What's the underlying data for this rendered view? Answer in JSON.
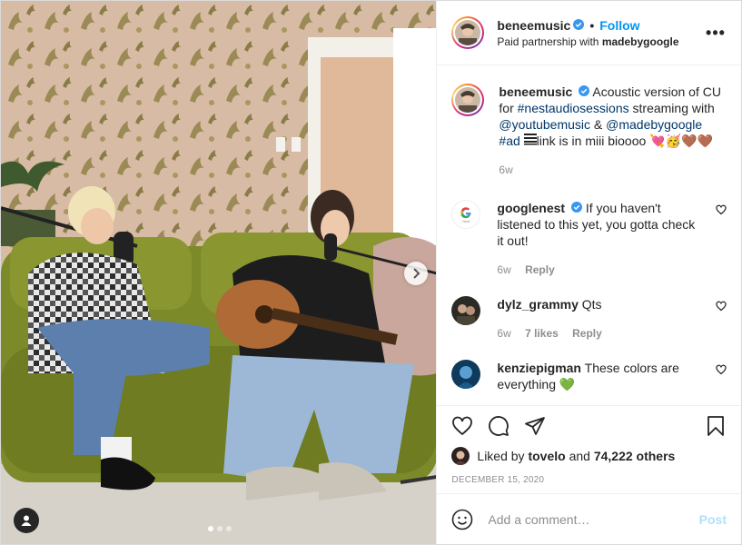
{
  "header": {
    "username": "beneemusic",
    "separator": "•",
    "follow_label": "Follow",
    "partnership_prefix": "Paid partnership with",
    "partner": "madebygoogle",
    "more_label": "•••"
  },
  "caption": {
    "username": "beneemusic",
    "text_1": "Acoustic version of CU for",
    "hashtag_1": "#nestaudiosessions",
    "text_2": "streaming with",
    "mention_1": "@youtubemusic",
    "text_3": "&",
    "mention_2": "@madebygoogle",
    "hashtag_2": "#ad",
    "text_4": "link is in miii bioooo 💘🥳🤎🤎",
    "time": "6w"
  },
  "comments": [
    {
      "username": "googlenest",
      "text": "If you haven't listened to this yet, you gotta check it out!",
      "time": "6w",
      "likes": "",
      "reply_label": "Reply",
      "avatar_label": "Nest"
    },
    {
      "username": "dylz_grammy",
      "text": "Qts",
      "time": "6w",
      "likes": "7 likes",
      "reply_label": "Reply"
    },
    {
      "username": "kenziepigman",
      "text": "These colors are everything 💚",
      "time": "",
      "likes": "",
      "reply_label": ""
    }
  ],
  "likes": {
    "prefix": "Liked by",
    "user": "tovelo",
    "and": "and",
    "count": "74,222 others"
  },
  "date": "DECEMBER 15, 2020",
  "add_comment": {
    "placeholder": "Add a comment…",
    "post_label": "Post"
  },
  "colors": {
    "accent": "#0095f6",
    "link": "#00376b",
    "muted": "#8e8e8e",
    "post_disabled": "#b2dffc"
  }
}
